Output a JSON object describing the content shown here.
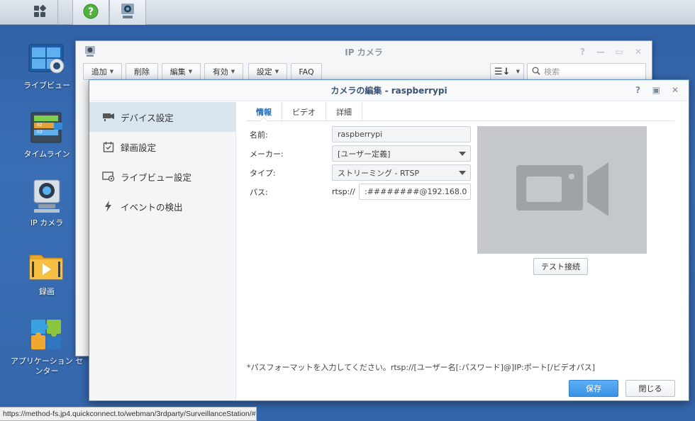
{
  "taskbar": {
    "items": [
      "main-menu",
      "help",
      "surveillance-station"
    ]
  },
  "desktop": {
    "icons": [
      {
        "label": "ライブビュー"
      },
      {
        "label": "タイムライン"
      },
      {
        "label": "IP カメラ"
      },
      {
        "label": "録画"
      },
      {
        "label": "アプリケーション センター"
      }
    ]
  },
  "bg_window": {
    "title": "IP カメラ",
    "toolbar": {
      "add": "追加",
      "delete": "削除",
      "edit": "編集",
      "enable": "有効",
      "settings": "設定",
      "faq": "FAQ",
      "search_placeholder": "検索"
    }
  },
  "dialog": {
    "title": "カメラの編集 - raspberrypi",
    "sidebar": [
      {
        "label": "デバイス設定"
      },
      {
        "label": "録画設定"
      },
      {
        "label": "ライブビュー設定"
      },
      {
        "label": "イベントの検出"
      }
    ],
    "tabs": [
      "情報",
      "ビデオ",
      "詳細"
    ],
    "form": {
      "name_label": "名前:",
      "name_value": "raspberrypi",
      "maker_label": "メーカー:",
      "maker_value": "[ユーザー定義]",
      "type_label": "タイプ:",
      "type_value": "ストリーミング - RTSP",
      "path_label": "パス:",
      "path_prefix": "rtsp://",
      "path_value": ":########@192.168.0"
    },
    "test_button": "テスト接続",
    "hint": "*パスフォーマットを入力してください。rtsp://[ユーザー名[:パスワード]@]IP:ポート[/ビデオパス]",
    "save_button": "保存",
    "close_button": "閉じる"
  },
  "statusbar": {
    "url": "https://method-fs.jp4.quickconnect.to/webman/3rdparty/SurveillanceStation/#"
  },
  "colors": {
    "desktop": "#3466ab",
    "accent": "#3a91e4",
    "active_tab": "#1e6bb8"
  }
}
